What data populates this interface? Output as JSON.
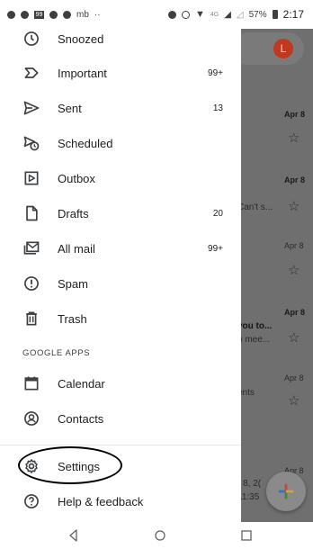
{
  "status_bar": {
    "left_badge": "99",
    "left_text": "mb",
    "signal_text": "4G",
    "battery": "57%",
    "time": "2:17"
  },
  "drawer": {
    "items_top": [
      {
        "label": "Snoozed",
        "count": "",
        "icon": "clock-icon"
      },
      {
        "label": "Important",
        "count": "99+",
        "icon": "important-icon"
      },
      {
        "label": "Sent",
        "count": "13",
        "icon": "send-icon"
      },
      {
        "label": "Scheduled",
        "count": "",
        "icon": "scheduled-send-icon"
      },
      {
        "label": "Outbox",
        "count": "",
        "icon": "outbox-icon"
      },
      {
        "label": "Drafts",
        "count": "20",
        "icon": "draft-icon"
      },
      {
        "label": "All mail",
        "count": "99+",
        "icon": "all-mail-icon"
      },
      {
        "label": "Spam",
        "count": "",
        "icon": "spam-icon"
      },
      {
        "label": "Trash",
        "count": "",
        "icon": "trash-icon"
      }
    ],
    "section_title": "GOOGLE APPS",
    "apps": [
      {
        "label": "Calendar",
        "icon": "calendar-icon"
      },
      {
        "label": "Contacts",
        "icon": "contacts-icon"
      }
    ],
    "settings_label": "Settings",
    "help_label": "Help & feedback"
  },
  "inbox": {
    "avatar_letter": "L",
    "dates": [
      "Apr 8",
      "Apr 8",
      "Apr 8",
      "Apr 8",
      "Apr 8",
      "Apr 8"
    ],
    "snippets": [
      "Can't s...",
      "you to...",
      "o mee...",
      "ents",
      "r 8, 2(",
      "11:35"
    ],
    "star_glyph": "☆"
  },
  "colors": {
    "scrim": "#6f6f6f",
    "avatar": "#c0391f"
  }
}
